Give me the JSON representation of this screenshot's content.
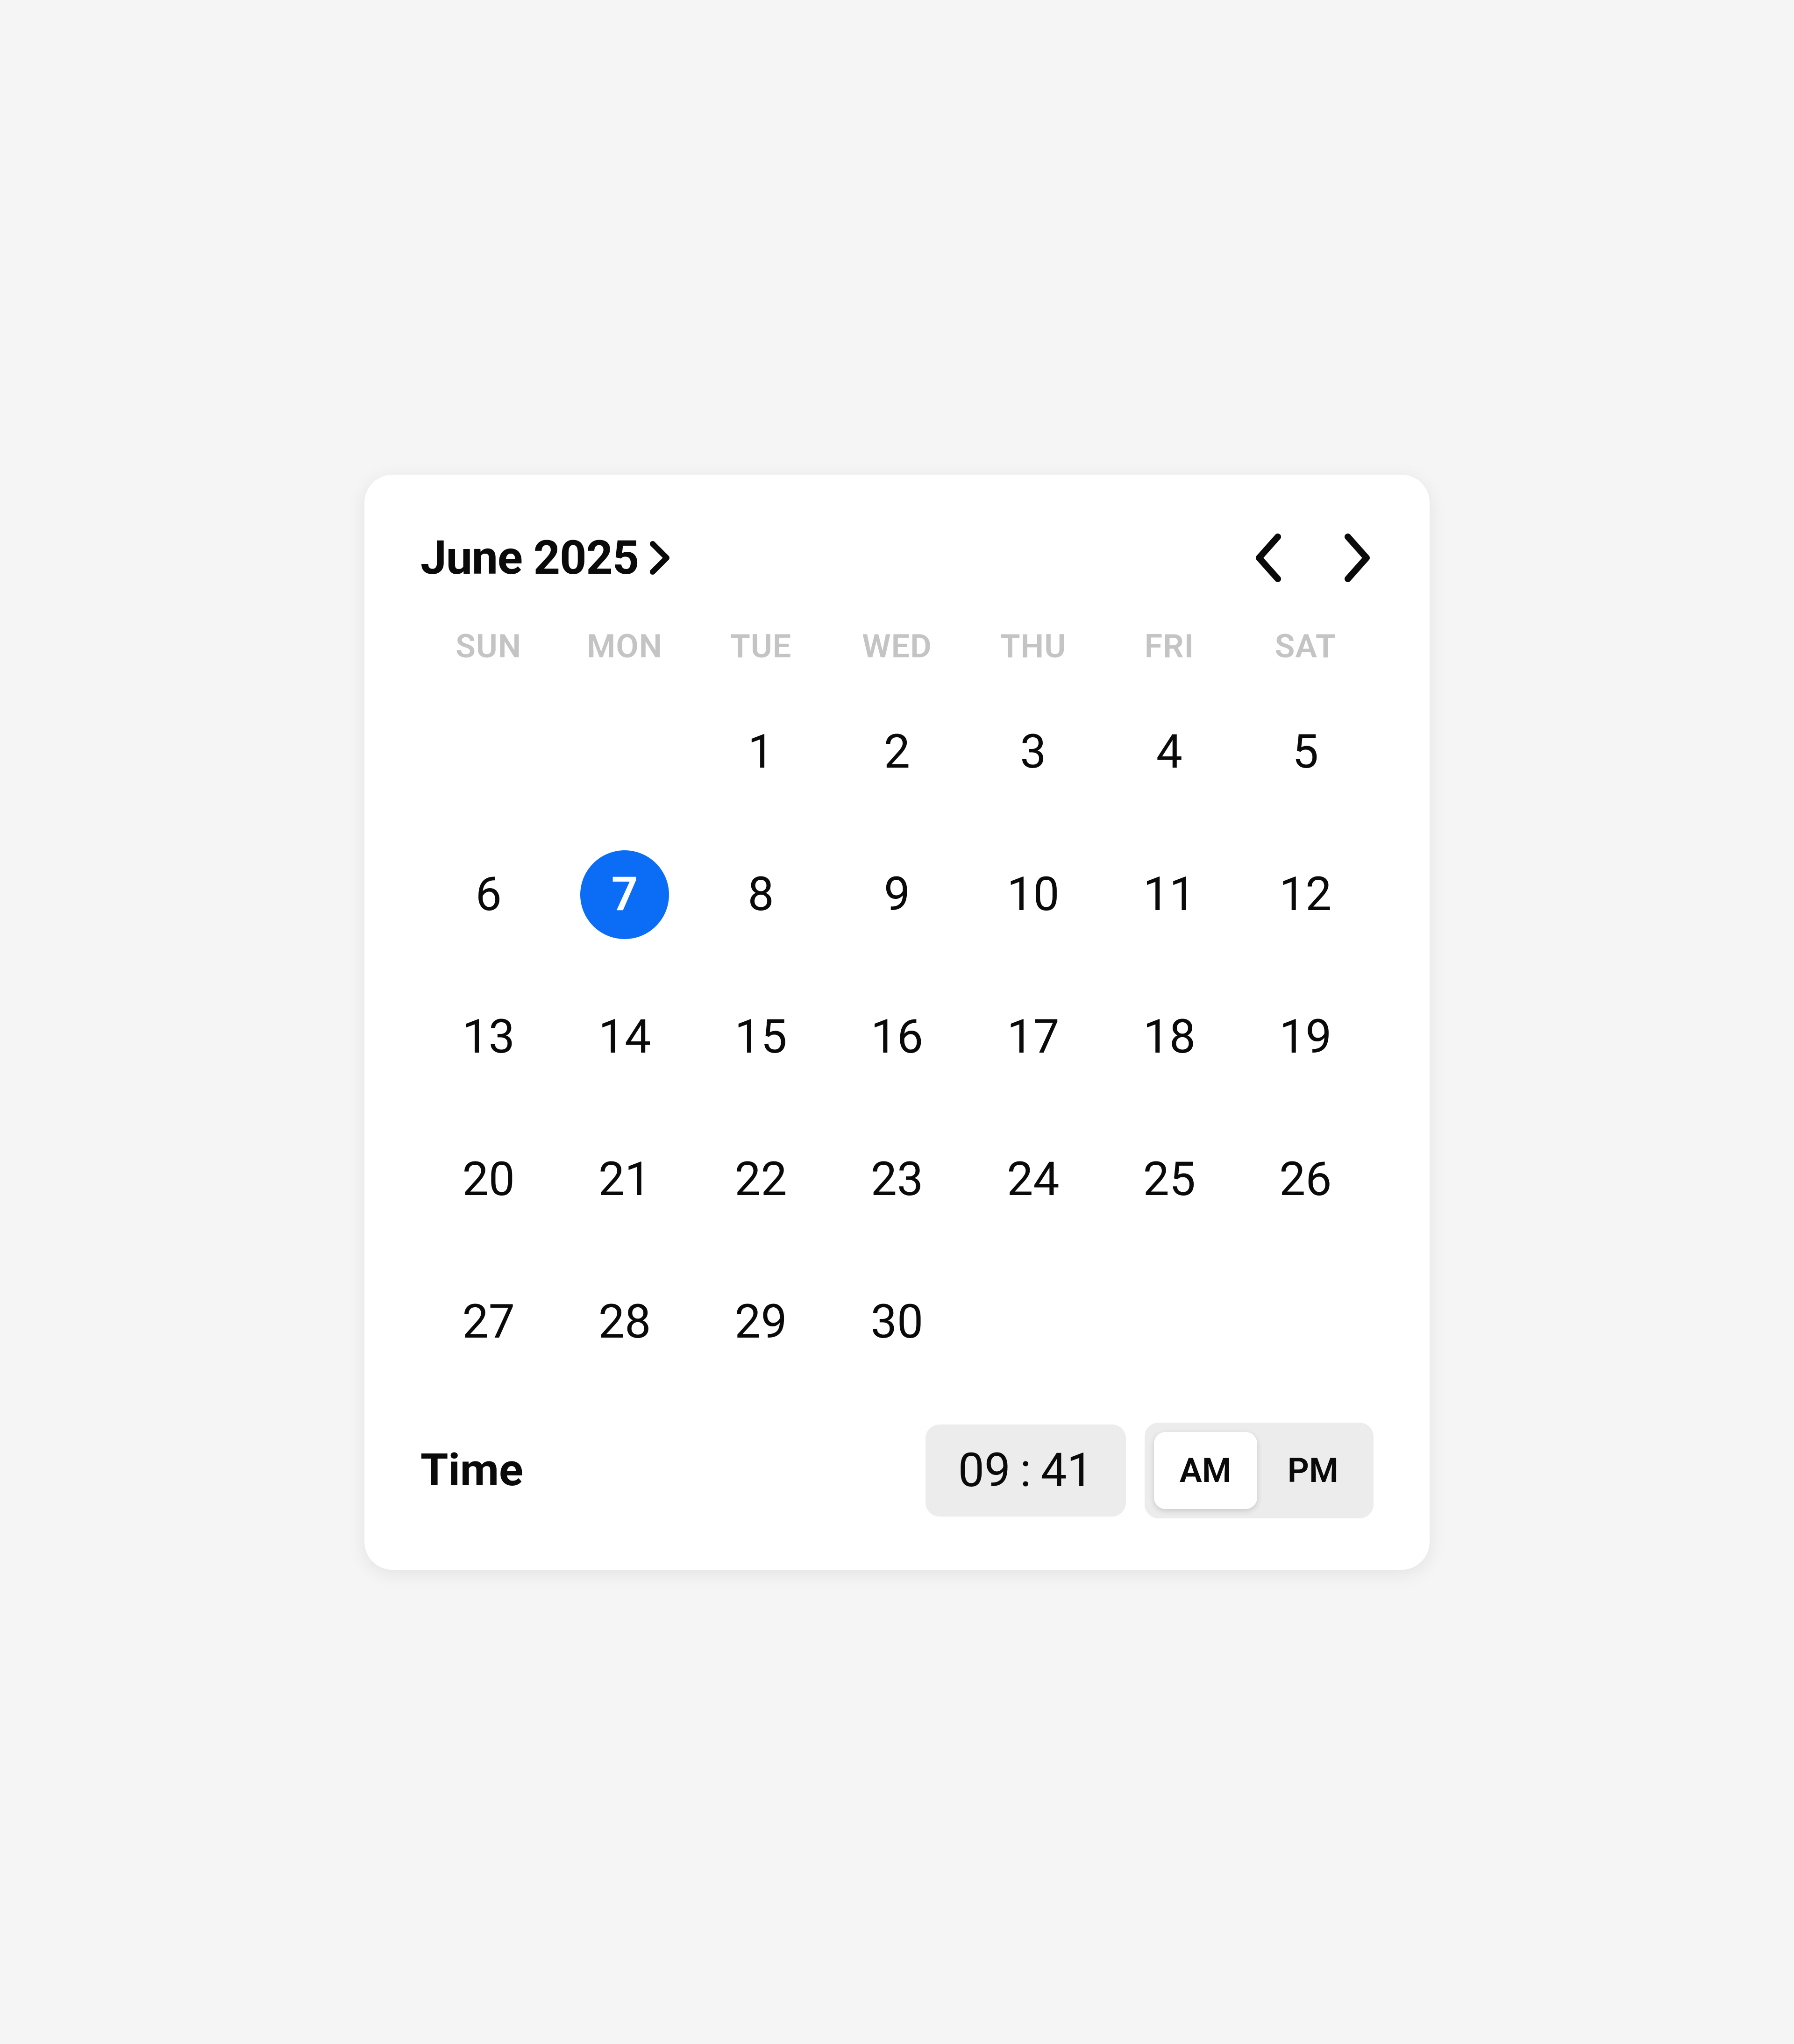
{
  "header": {
    "month_year": "June 2025"
  },
  "weekdays": [
    "SUN",
    "MON",
    "TUE",
    "WED",
    "THU",
    "FRI",
    "SAT"
  ],
  "calendar": {
    "leading_blanks": 2,
    "days": [
      1,
      2,
      3,
      4,
      5,
      6,
      7,
      8,
      9,
      10,
      11,
      12,
      13,
      14,
      15,
      16,
      17,
      18,
      19,
      20,
      21,
      22,
      23,
      24,
      25,
      26,
      27,
      28,
      29,
      30
    ],
    "selected_day": 7
  },
  "time": {
    "label": "Time",
    "hour": "09",
    "minute": "41",
    "am_label": "AM",
    "pm_label": "PM",
    "selected_period": "AM"
  },
  "colors": {
    "accent": "#0b6cf6",
    "background": "#ffffff",
    "page_background": "#f5f5f5",
    "muted": "#c4c4c4",
    "control_bg": "#ececec",
    "text": "#0a0a0a"
  }
}
